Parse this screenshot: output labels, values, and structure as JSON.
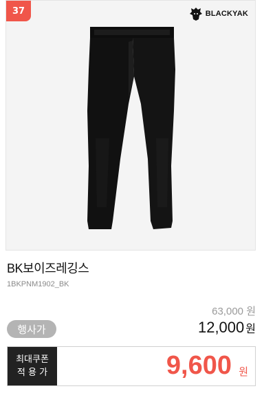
{
  "badge": {
    "rank": "37",
    "color": "#f0564a"
  },
  "brand": {
    "name": "BLACKYAK",
    "logo_icon": "yak-head-icon"
  },
  "product": {
    "name": "BK보이즈레깅스",
    "code": "1BKPNM1902_BK",
    "image_icon": "black-leggings-image"
  },
  "pricing": {
    "original_price": "63,000",
    "original_unit": "원",
    "sale_tag": "행사가",
    "sale_price": "12,000",
    "sale_unit": "원",
    "coupon_label_line1": "최대쿠폰",
    "coupon_label_line2": "적 용 가",
    "coupon_price": "9,600",
    "coupon_unit": "원",
    "accent_color": "#f0564a"
  }
}
